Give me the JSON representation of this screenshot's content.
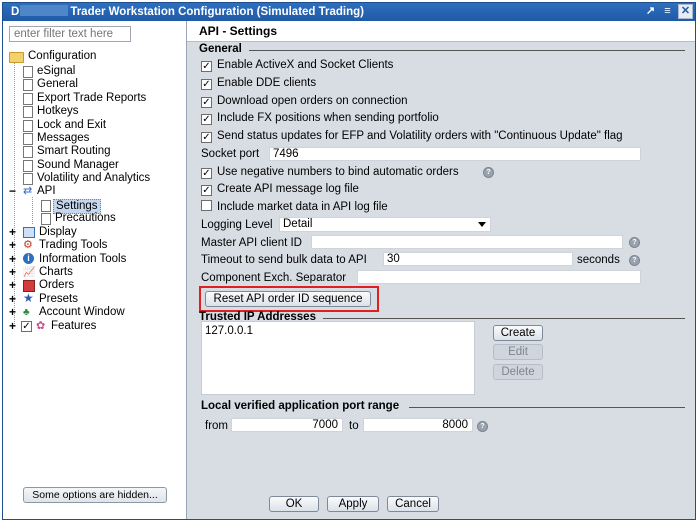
{
  "window": {
    "title_prefix": "D",
    "title": "Trader Workstation Configuration (Simulated Trading)",
    "buttons": [
      "↗",
      "≡",
      "✕"
    ]
  },
  "sidebar": {
    "filter_placeholder": "enter filter text here",
    "root": "Configuration",
    "items": [
      {
        "label": "eSignal"
      },
      {
        "label": "General"
      },
      {
        "label": "Export Trade Reports"
      },
      {
        "label": "Hotkeys"
      },
      {
        "label": "Lock and Exit"
      },
      {
        "label": "Messages"
      },
      {
        "label": "Smart Routing"
      },
      {
        "label": "Sound Manager"
      },
      {
        "label": "Volatility and Analytics"
      },
      {
        "label": "API"
      },
      {
        "label": "Settings"
      },
      {
        "label": "Precautions"
      },
      {
        "label": "Display"
      },
      {
        "label": "Trading Tools"
      },
      {
        "label": "Information Tools"
      },
      {
        "label": "Charts"
      },
      {
        "label": "Orders"
      },
      {
        "label": "Presets"
      },
      {
        "label": "Account Window"
      },
      {
        "label": "Features"
      }
    ],
    "hidden_options_button": "Some options are hidden..."
  },
  "main": {
    "header": "API - Settings",
    "general_label": "General",
    "checks": [
      {
        "label": "Enable ActiveX and Socket Clients",
        "checked": true
      },
      {
        "label": "Enable DDE clients",
        "checked": true
      },
      {
        "label": "Download open orders on connection",
        "checked": true
      },
      {
        "label": "Include FX positions when sending portfolio",
        "checked": true
      },
      {
        "label": "Send status updates for EFP and Volatility orders with \"Continuous Update\" flag",
        "checked": true
      }
    ],
    "socket_port_label": "Socket port",
    "socket_port_value": "7496",
    "checks2": [
      {
        "label": "Use negative numbers to bind automatic orders",
        "checked": true
      },
      {
        "label": "Create API message log file",
        "checked": true
      },
      {
        "label": "Include market data in API log file",
        "checked": false
      }
    ],
    "logging_level_label": "Logging Level",
    "logging_level_value": "Detail",
    "master_client_label": "Master API client ID",
    "master_client_value": "",
    "timeout_label": "Timeout to send bulk data to API",
    "timeout_value": "30",
    "timeout_unit": "seconds",
    "separator_label": "Component Exch. Separator",
    "separator_value": "",
    "reset_button": "Reset API order ID sequence",
    "trusted_label": "Trusted IP Addresses",
    "trusted_ips": [
      "127.0.0.1"
    ],
    "create_button": "Create",
    "edit_button": "Edit",
    "delete_button": "Delete",
    "port_range_label": "Local verified application port range",
    "from_label": "from",
    "from_value": "7000",
    "to_label": "to",
    "to_value": "8000"
  },
  "footer": {
    "ok": "OK",
    "apply": "Apply",
    "cancel": "Cancel"
  },
  "colors": {
    "titlebar": "#1f5aa6",
    "highlight_box": "#e02020"
  }
}
